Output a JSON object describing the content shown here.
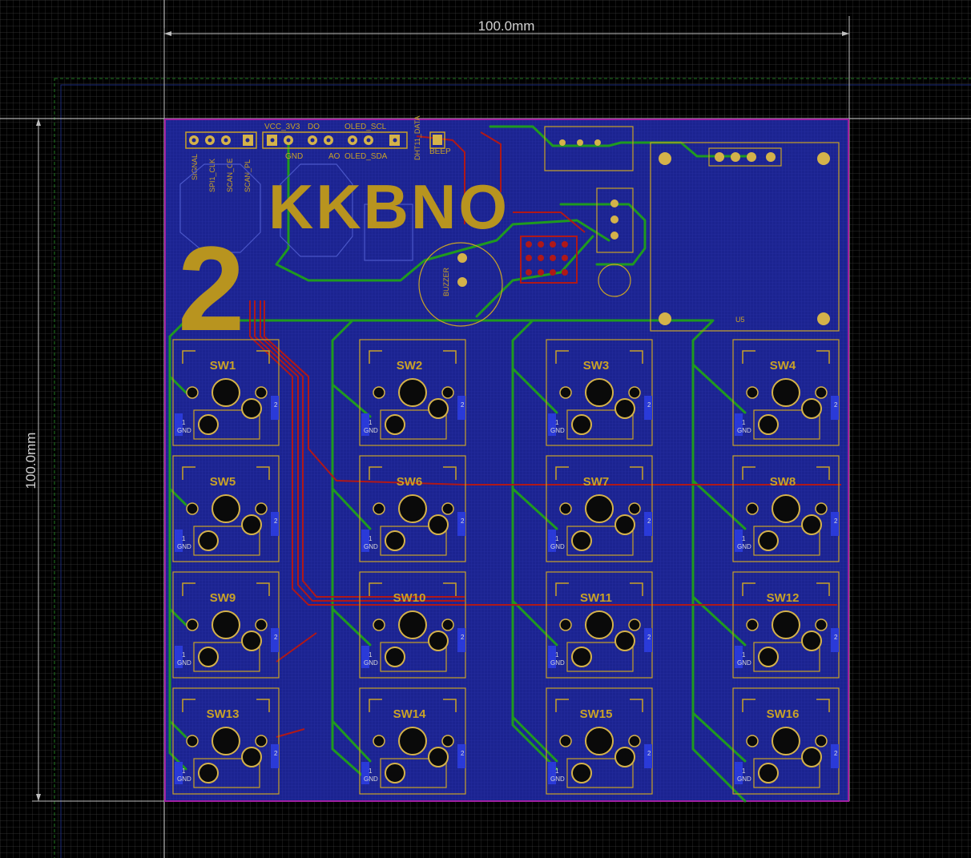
{
  "dimensions": {
    "horizontal": "100.0mm",
    "vertical": "100.0mm"
  },
  "board": {
    "title": "KKBNO",
    "revision": "2",
    "colors": {
      "background": "#000000",
      "grid": "#2e2e2e",
      "board_fill": "#1a1f8c",
      "outline": "#a020a0",
      "bottom_trace": "#1f8a1f",
      "top_trace": "#b01818",
      "silkscreen": "#c9a227",
      "pad": "#d4b24a"
    }
  },
  "header_labels": {
    "top": [
      "VCC_3V3",
      "DO",
      "OLED_SCL"
    ],
    "bottom": [
      "GND",
      "AO",
      "OLED_SDA"
    ],
    "vertical": [
      "SIGNAL",
      "SPI1_CLK",
      "SCAN_CE",
      "SCAN_PL",
      "DHT11_DATA"
    ],
    "beep": "BEEP",
    "buzzer": "BUZZER",
    "module": "U5"
  },
  "switches": [
    {
      "label": "SW1",
      "pin1": "1",
      "pin2": "2",
      "gnd": "GND"
    },
    {
      "label": "SW2",
      "pin1": "1",
      "pin2": "2",
      "gnd": "GND"
    },
    {
      "label": "SW3",
      "pin1": "1",
      "pin2": "2",
      "gnd": "GND"
    },
    {
      "label": "SW4",
      "pin1": "1",
      "pin2": "2",
      "gnd": "GND"
    },
    {
      "label": "SW5",
      "pin1": "1",
      "pin2": "2",
      "gnd": "GND"
    },
    {
      "label": "SW6",
      "pin1": "1",
      "pin2": "2",
      "gnd": "GND"
    },
    {
      "label": "SW7",
      "pin1": "1",
      "pin2": "2",
      "gnd": "GND"
    },
    {
      "label": "SW8",
      "pin1": "1",
      "pin2": "2",
      "gnd": "GND"
    },
    {
      "label": "SW9",
      "pin1": "1",
      "pin2": "2",
      "gnd": "GND"
    },
    {
      "label": "SW10",
      "pin1": "1",
      "pin2": "2",
      "gnd": "GND"
    },
    {
      "label": "SW11",
      "pin1": "1",
      "pin2": "2",
      "gnd": "GND"
    },
    {
      "label": "SW12",
      "pin1": "1",
      "pin2": "2",
      "gnd": "GND"
    },
    {
      "label": "SW13",
      "pin1": "1",
      "pin2": "2",
      "gnd": "GND"
    },
    {
      "label": "SW14",
      "pin1": "1",
      "pin2": "2",
      "gnd": "GND"
    },
    {
      "label": "SW15",
      "pin1": "1",
      "pin2": "2",
      "gnd": "GND"
    },
    {
      "label": "SW16",
      "pin1": "1",
      "pin2": "2",
      "gnd": "GND"
    }
  ]
}
